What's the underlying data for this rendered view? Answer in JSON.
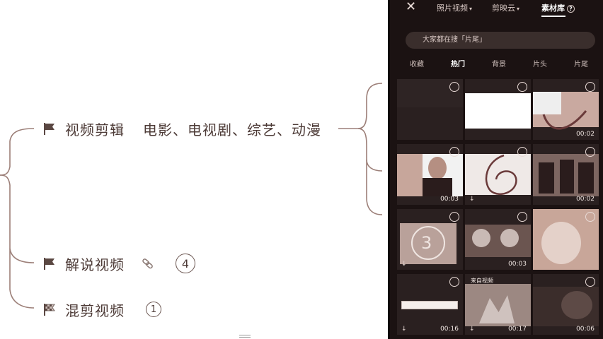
{
  "mindmap": {
    "nodes": [
      {
        "label": "视频剪辑",
        "sub": "电影、电视剧、综艺、动漫"
      },
      {
        "label": "解说视频",
        "badge": "4"
      },
      {
        "label": "混剪视频",
        "badge": "1"
      }
    ]
  },
  "phone": {
    "close_icon": "close-icon",
    "tabs": [
      {
        "label": "照片视频"
      },
      {
        "label": "剪映云"
      },
      {
        "label": "素材库"
      }
    ],
    "search_placeholder": "大家都在搜「片尾」",
    "categories": [
      "收藏",
      "热门",
      "背景",
      "片头",
      "片尾"
    ],
    "active_category": "热门",
    "items": [
      {
        "duration": ""
      },
      {
        "duration": ""
      },
      {
        "duration": "00:02"
      },
      {
        "duration": "00:03"
      },
      {
        "duration": ""
      },
      {
        "duration": "00:02"
      },
      {
        "duration": ""
      },
      {
        "duration": "00:03"
      },
      {
        "duration": ""
      },
      {
        "duration": "00:16"
      },
      {
        "duration": "00:17",
        "tag": "来自视频"
      },
      {
        "duration": "00:06"
      }
    ]
  },
  "colors": {
    "branch": "#9c7f78",
    "phone_bg": "#1b1212",
    "text": "#4d3b37"
  }
}
